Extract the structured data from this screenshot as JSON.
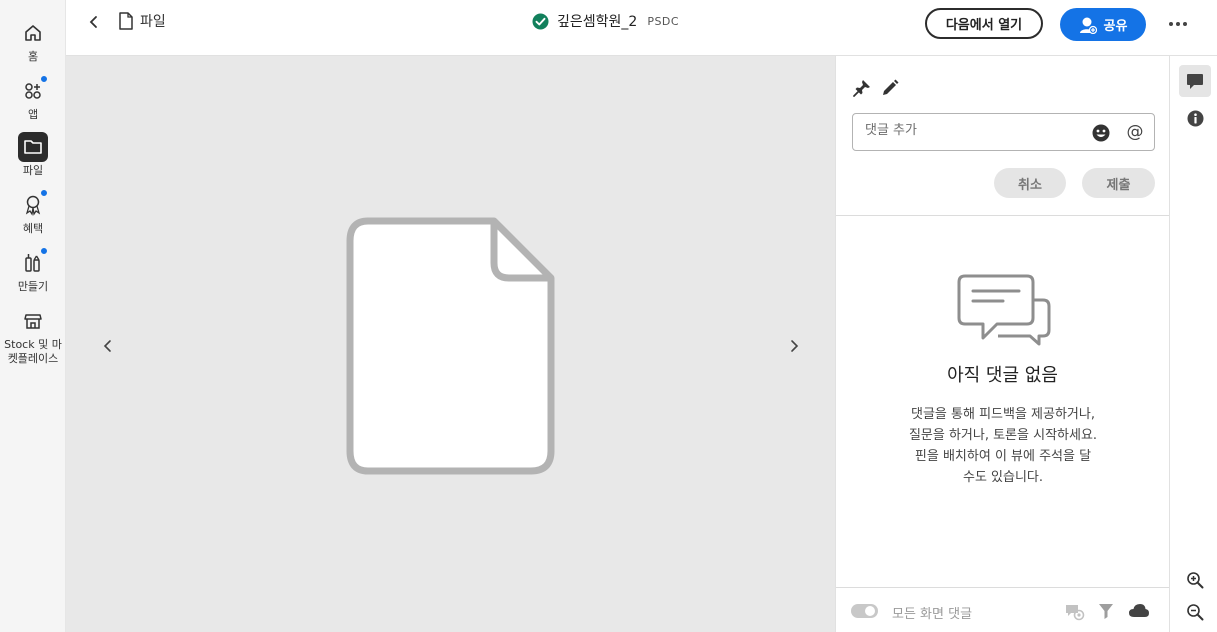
{
  "rail": {
    "items": [
      {
        "label": "홈",
        "icon": "home-icon",
        "badge": false
      },
      {
        "label": "앱",
        "icon": "apps-icon",
        "badge": true
      },
      {
        "label": "파일",
        "icon": "folder-icon",
        "badge": false,
        "active": true
      },
      {
        "label": "혜택",
        "icon": "award-icon",
        "badge": true
      },
      {
        "label": "만들기",
        "icon": "create-icon",
        "badge": true
      },
      {
        "label": "Stock 및 마켓플레이스",
        "icon": "store-icon",
        "badge": false
      }
    ]
  },
  "topbar": {
    "breadcrumb": "파일",
    "doc_title": "깊은셈학원_2",
    "doc_type": "PSDC",
    "open_in_label": "다음에서 열기",
    "share_label": "공유"
  },
  "comments": {
    "input_placeholder": "댓글 추가",
    "cancel_label": "취소",
    "submit_label": "제출",
    "empty_title": "아직 댓글 없음",
    "empty_desc": "댓글을 통해 피드백을 제공하거나, 질문을 하거나, 토론을 시작하세요. 핀을 배치하여 이 뷰에 주석을 달 수도 있습니다.",
    "footer_toggle_label": "모든 화면 댓글"
  },
  "colors": {
    "accent": "#1473e6",
    "status_ok": "#12805c",
    "rail_active": "#2c2c2c"
  }
}
